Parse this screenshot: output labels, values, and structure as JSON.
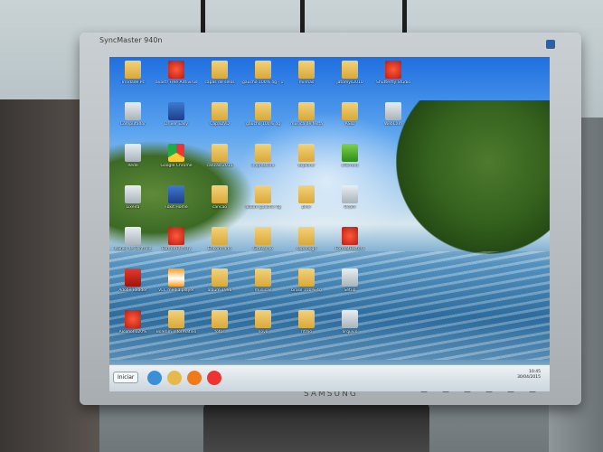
{
  "monitor": {
    "brand_label": "SyncMaster 940n",
    "bottom_logo": "SAMSUNG"
  },
  "desktop": {
    "icons": [
      {
        "label": "Trindade.Pc",
        "kind": "folder",
        "col": 0,
        "row": 0
      },
      {
        "label": "avast! Free Antivirus",
        "kind": "app-red",
        "col": 1,
        "row": 0
      },
      {
        "label": "capas de selos",
        "kind": "folder",
        "col": 2,
        "row": 0
      },
      {
        "label": "gaucho 100% 4g - 1996",
        "kind": "folder",
        "col": 3,
        "row": 0
      },
      {
        "label": "minhas",
        "kind": "folder",
        "col": 4,
        "row": 0
      },
      {
        "label": "jatomys2010",
        "kind": "folder",
        "col": 5,
        "row": 0
      },
      {
        "label": "Shutterfly Studio",
        "kind": "app-red",
        "col": 6,
        "row": 0
      },
      {
        "label": "Computador",
        "kind": "app-gray",
        "col": 0,
        "row": 1
      },
      {
        "label": "Driver Easy",
        "kind": "app-blue",
        "col": 1,
        "row": 1
      },
      {
        "label": "CapaDVD",
        "kind": "folder",
        "col": 2,
        "row": 1
      },
      {
        "label": "gaucho 100% 4g",
        "kind": "folder",
        "col": 3,
        "row": 1
      },
      {
        "label": "musica de festa",
        "kind": "folder",
        "col": 4,
        "row": 1
      },
      {
        "label": "ASID",
        "kind": "folder",
        "col": 5,
        "row": 1
      },
      {
        "label": "WebCam",
        "kind": "app-gray",
        "col": 6,
        "row": 1
      },
      {
        "label": "Rede",
        "kind": "app-gray",
        "col": 0,
        "row": 2
      },
      {
        "label": "Google Chrome",
        "kind": "app-chrome",
        "col": 1,
        "row": 2
      },
      {
        "label": "cancao 2015",
        "kind": "folder",
        "col": 2,
        "row": 2
      },
      {
        "label": "impressora",
        "kind": "folder",
        "col": 3,
        "row": 2
      },
      {
        "label": "explorer",
        "kind": "folder",
        "col": 4,
        "row": 2
      },
      {
        "label": "uTorrent",
        "kind": "app-green",
        "col": 5,
        "row": 2
      },
      {
        "label": "Lixeira",
        "kind": "app-gray",
        "col": 0,
        "row": 3
      },
      {
        "label": "Foxit Home",
        "kind": "app-blue",
        "col": 1,
        "row": 3
      },
      {
        "label": "cancao",
        "kind": "folder",
        "col": 2,
        "row": 3
      },
      {
        "label": "album gaucho 4g",
        "kind": "folder",
        "col": 3,
        "row": 3
      },
      {
        "label": "phar",
        "kind": "folder",
        "col": 4,
        "row": 3
      },
      {
        "label": "Ocam",
        "kind": "app-gray",
        "col": 5,
        "row": 3
      },
      {
        "label": "Painel de Controle",
        "kind": "app-gray",
        "col": 0,
        "row": 4
      },
      {
        "label": "FormatFactory",
        "kind": "app-red",
        "col": 1,
        "row": 4
      },
      {
        "label": "Encontrado",
        "kind": "folder",
        "col": 2,
        "row": 4
      },
      {
        "label": "Gravacao",
        "kind": "folder",
        "col": 3,
        "row": 4
      },
      {
        "label": "cop.mogo",
        "kind": "folder",
        "col": 4,
        "row": 4
      },
      {
        "label": "FormatFactory",
        "kind": "app-red",
        "col": 5,
        "row": 4
      },
      {
        "label": "Adobe Reader",
        "kind": "app-pdf",
        "col": 0,
        "row": 5
      },
      {
        "label": "VLC media player",
        "kind": "app-cone",
        "col": 1,
        "row": 5
      },
      {
        "label": "album 1996",
        "kind": "folder",
        "col": 2,
        "row": 5
      },
      {
        "label": "musicas",
        "kind": "folder",
        "col": 3,
        "row": 5
      },
      {
        "label": "brasil 100% 4g",
        "kind": "folder",
        "col": 4,
        "row": 5
      },
      {
        "label": "Setup",
        "kind": "app-gray",
        "col": 5,
        "row": 5
      },
      {
        "label": "Alcohol 120%",
        "kind": "app-red",
        "col": 0,
        "row": 6
      },
      {
        "label": "Boletim Informativo",
        "kind": "folder",
        "col": 1,
        "row": 6
      },
      {
        "label": "fotos",
        "kind": "folder",
        "col": 2,
        "row": 6
      },
      {
        "label": "novo",
        "kind": "folder",
        "col": 3,
        "row": 6
      },
      {
        "label": "ritmo",
        "kind": "folder",
        "col": 4,
        "row": 6
      },
      {
        "label": "arquivo",
        "kind": "app-gray",
        "col": 5,
        "row": 6
      }
    ]
  },
  "taskbar": {
    "start_label": "Iniciar",
    "clock_time": "10:45",
    "clock_date": "30/04/2015",
    "pinned": [
      {
        "name": "ie-icon",
        "color": "#3a8fd8"
      },
      {
        "name": "explorer-icon",
        "color": "#e7b94a"
      },
      {
        "name": "media-player-icon",
        "color": "#f07a1a"
      },
      {
        "name": "chrome-icon",
        "color": "#e33"
      }
    ]
  }
}
